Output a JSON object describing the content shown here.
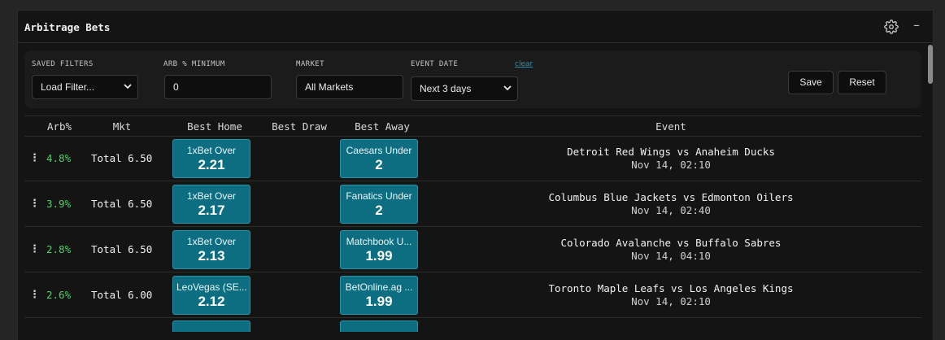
{
  "title": "Arbitrage Bets",
  "icons": {
    "settings": "gear-icon",
    "minimize": "minimize-icon"
  },
  "colors": {
    "accent": "#0d6e82",
    "positive": "#4fd06a",
    "link": "#3a8bb0"
  },
  "filters": {
    "saved_label": "SAVED FILTERS",
    "saved_value": "Load Filter...",
    "arb_label": "ARB % MINIMUM",
    "arb_value": "0",
    "market_label": "MARKET",
    "market_value": "All Markets",
    "date_label": "EVENT DATE",
    "date_value": "Next 3 days",
    "clear_label": "clear",
    "save_label": "Save",
    "reset_label": "Reset"
  },
  "table": {
    "headers": {
      "arb": "Arb%",
      "mkt": "Mkt",
      "home": "Best Home",
      "draw": "Best Draw",
      "away": "Best Away",
      "event": "Event"
    },
    "rows": [
      {
        "arb": "4.8%",
        "mkt": "Total 6.50",
        "home_book": "1xBet  Over",
        "home_price": "2.21",
        "away_book": "Caesars Under",
        "away_price": "2",
        "event": "Detroit Red Wings vs Anaheim Ducks",
        "time": "Nov 14, 02:10"
      },
      {
        "arb": "3.9%",
        "mkt": "Total 6.50",
        "home_book": "1xBet  Over",
        "home_price": "2.17",
        "away_book": "Fanatics Under",
        "away_price": "2",
        "event": "Columbus Blue Jackets vs Edmonton Oilers",
        "time": "Nov 14, 02:40"
      },
      {
        "arb": "2.8%",
        "mkt": "Total 6.50",
        "home_book": "1xBet  Over",
        "home_price": "2.13",
        "away_book": "Matchbook U...",
        "away_price": "1.99",
        "event": "Colorado Avalanche vs Buffalo Sabres",
        "time": "Nov 14, 04:10"
      },
      {
        "arb": "2.6%",
        "mkt": "Total 6.00",
        "home_book": "LeoVegas (SE...",
        "home_price": "2.12",
        "away_book": "BetOnline.ag ...",
        "away_price": "1.99",
        "event": "Toronto Maple Leafs vs Los Angeles Kings",
        "time": "Nov 14, 02:10"
      }
    ]
  }
}
